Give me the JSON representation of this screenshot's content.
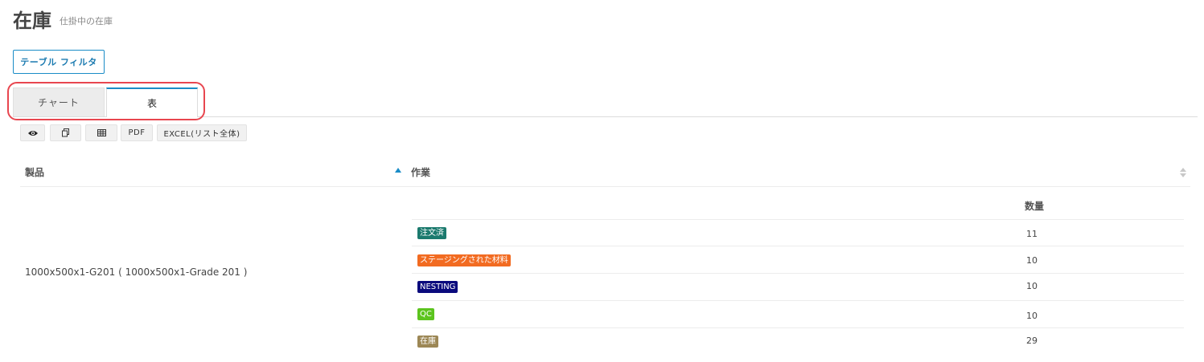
{
  "page": {
    "title": "在庫",
    "subtitle": "仕掛中の在庫"
  },
  "filter_button": {
    "label": "テーブル フィルタ"
  },
  "tabs": [
    {
      "label": "チャート",
      "active": false
    },
    {
      "label": "表",
      "active": true
    }
  ],
  "toolbar": {
    "view_icon": "eye-icon",
    "copy_icon": "copy-icon",
    "columns_icon": "grid-icon",
    "pdf_label": "PDF",
    "excel_label": "EXCEL(リスト全体)"
  },
  "table": {
    "columns": [
      {
        "label": "製品",
        "sort": "asc"
      },
      {
        "label": "作業",
        "sort": "none"
      }
    ],
    "sub_header": "数量",
    "product": "1000x500x1-G201 ( 1000x500x1-Grade 201 )",
    "rows": [
      {
        "status": "注文済",
        "color": "#1b7a6e",
        "quantity": "11"
      },
      {
        "status": "ステージングされた材料",
        "color": "#f26b21",
        "quantity": "10"
      },
      {
        "status": "NESTING",
        "color": "#0a0a7d",
        "quantity": "10"
      },
      {
        "status": "QC",
        "color": "#5cc41e",
        "quantity": "10"
      },
      {
        "status": "在庫",
        "color": "#9c8755",
        "quantity": "29"
      }
    ]
  },
  "colors": {
    "accent": "#1a8cc7",
    "highlight": "#e8464f"
  }
}
